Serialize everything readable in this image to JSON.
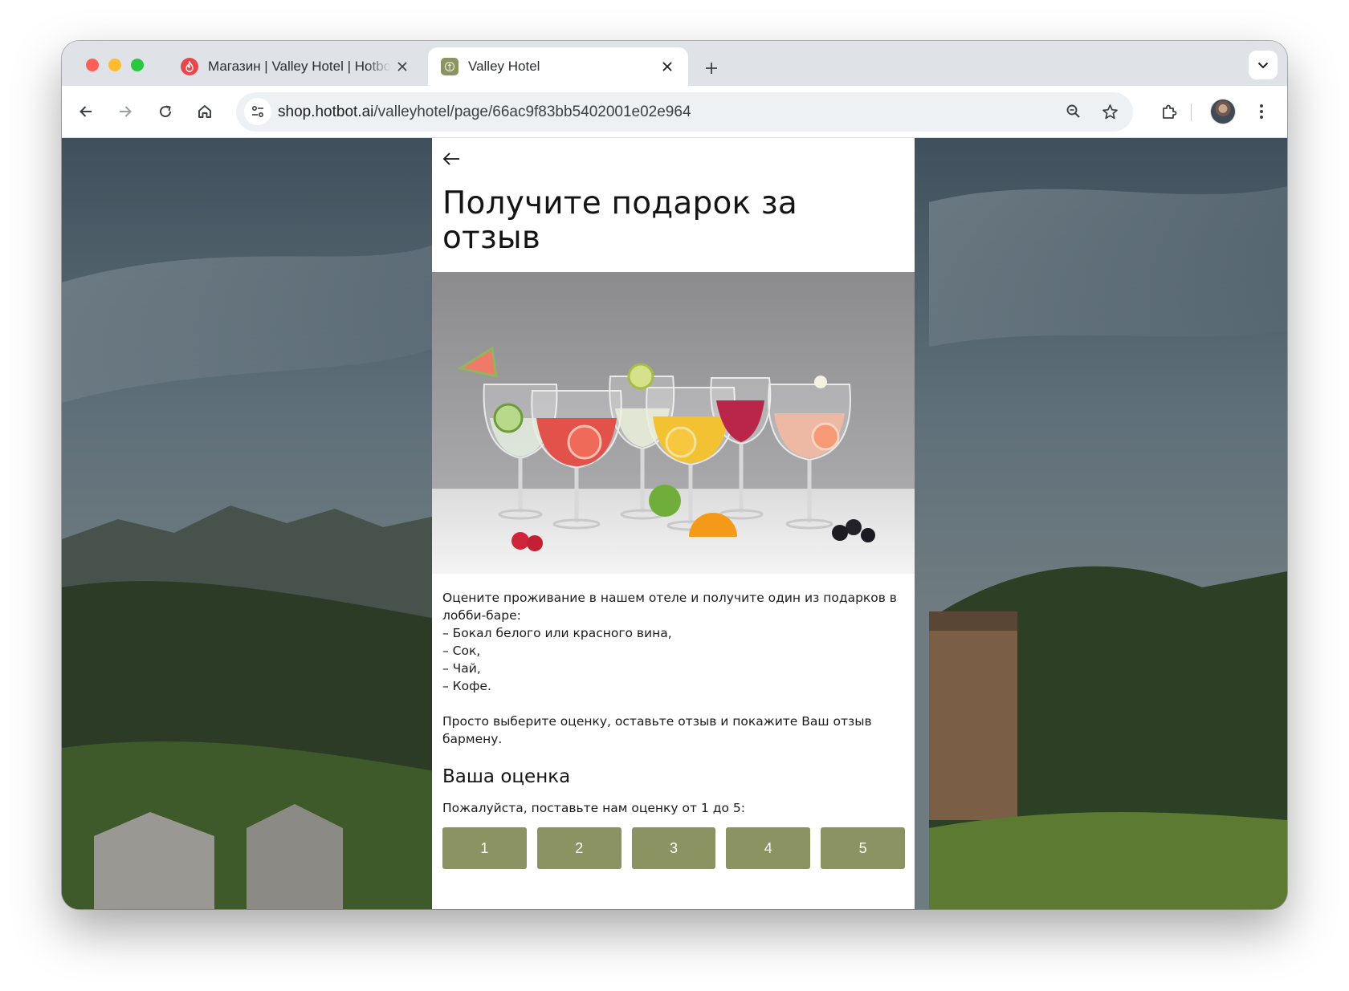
{
  "browser": {
    "tabs": [
      {
        "title": "Магазин | Valley Hotel | Hotbot",
        "favicon": "hotbot-flame-icon",
        "active": false
      },
      {
        "title": "Valley Hotel",
        "favicon": "valley-hotel-logo-icon",
        "active": true
      }
    ],
    "url_host": "shop.hotbot.ai",
    "url_path": "/valleyhotel/page/66ac9f83bb5402001e02e964",
    "accent": "#8a9361"
  },
  "page": {
    "title": "Получите подарок за отзыв",
    "description": "Оцените проживание в нашем отеле и получите один из подарков в лобби-баре:\n– Бокал белого или красного вина,\n– Сок,\n– Чай,\n– Кофе.\n\nПросто выберите оценку, оставьте отзыв и покажите Ваш отзыв бармену.",
    "rating": {
      "heading": "Ваша оценка",
      "hint": "Пожалуйста, поставьте нам оценку от 1 до 5:",
      "options": [
        "1",
        "2",
        "3",
        "4",
        "5"
      ],
      "button_color": "#8a9361"
    }
  }
}
